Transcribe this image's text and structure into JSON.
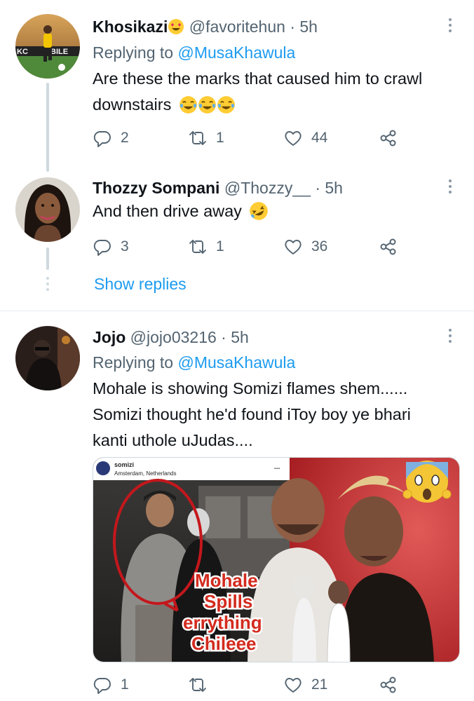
{
  "tweets": [
    {
      "name": "Khosikazi",
      "name_emoji": "smiling-face-with-heart-eyes",
      "handle": "@favoritehun",
      "sep": "·",
      "time": "5h",
      "replying_prefix": "Replying to",
      "replying_to": "@MusaKhawula",
      "body_lines": [
        "Are these the marks that caused him to crawl",
        "downstairs"
      ],
      "body_emoji": [
        "face-with-tears-of-joy",
        "face-with-tears-of-joy",
        "face-with-tears-of-joy"
      ],
      "replies": "2",
      "retweets": "1",
      "likes": "44"
    },
    {
      "name": "Thozzy Sompani",
      "handle": "@Thozzy__",
      "sep": "·",
      "time": "5h",
      "body_lines": [
        "And then drive away"
      ],
      "body_emoji": [
        "rolling-on-the-floor-laughing"
      ],
      "replies": "3",
      "retweets": "1",
      "likes": "36"
    },
    {
      "name": "Jojo",
      "handle": "@jojo03216",
      "sep": "·",
      "time": "5h",
      "replying_prefix": "Replying to",
      "replying_to": "@MusaKhawula",
      "body_lines": [
        "Mohale is showing Somizi flames shem......",
        "Somizi thought he'd found iToy boy ye bhari",
        "kanti uthole uJudas...."
      ],
      "replies": "1",
      "retweets": "",
      "likes": "21",
      "media": {
        "ig_username": "somizi",
        "ig_location": "Amsterdam, Netherlands",
        "ig_more": "...",
        "caption_lines": [
          "Mohale",
          "Spills",
          "errything",
          "Chileee"
        ],
        "emoji": "face-screaming-in-fear"
      }
    }
  ],
  "show_replies": "Show replies",
  "colors": {
    "accent": "#1d9bf0",
    "text": "#0f1419",
    "secondary": "#536471",
    "thread_line": "#cfd9de",
    "caption_red": "#d32b1e"
  }
}
